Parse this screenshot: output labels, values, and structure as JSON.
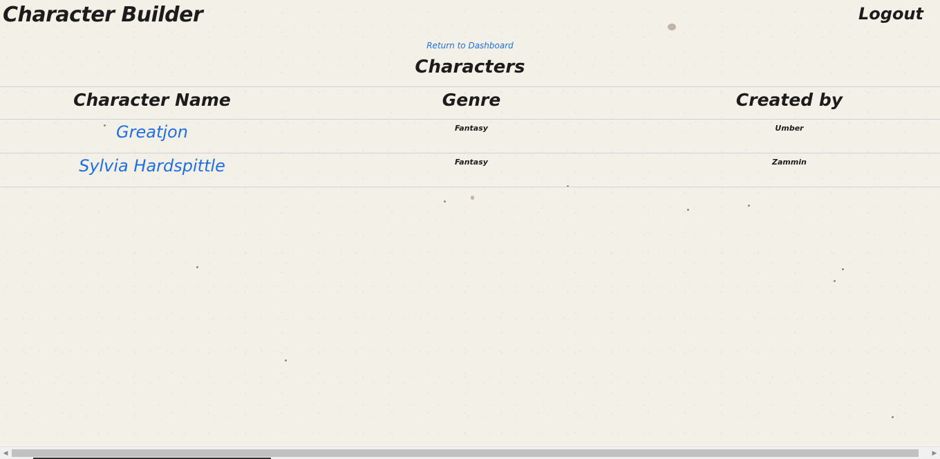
{
  "navbar": {
    "brand": "Character Builder",
    "logout_label": "Logout"
  },
  "return_link": "Return to Dashboard",
  "page_title": "Characters",
  "table": {
    "headers": [
      "Character Name",
      "Genre",
      "Created by"
    ],
    "rows": [
      {
        "name": "Greatjon",
        "genre": "Fantasy",
        "created_by": "Umber"
      },
      {
        "name": "Sylvia Hardspittle",
        "genre": "Fantasy",
        "created_by": "Zammin"
      }
    ]
  },
  "scrollbar": {
    "left_arrow_icon": "arrow-left-icon",
    "right_arrow_icon": "arrow-right-icon"
  },
  "colors": {
    "link": "#1f6fe0",
    "text": "#1c1c1c",
    "divider": "#cfd2d8",
    "background": "#f3f0e8"
  }
}
